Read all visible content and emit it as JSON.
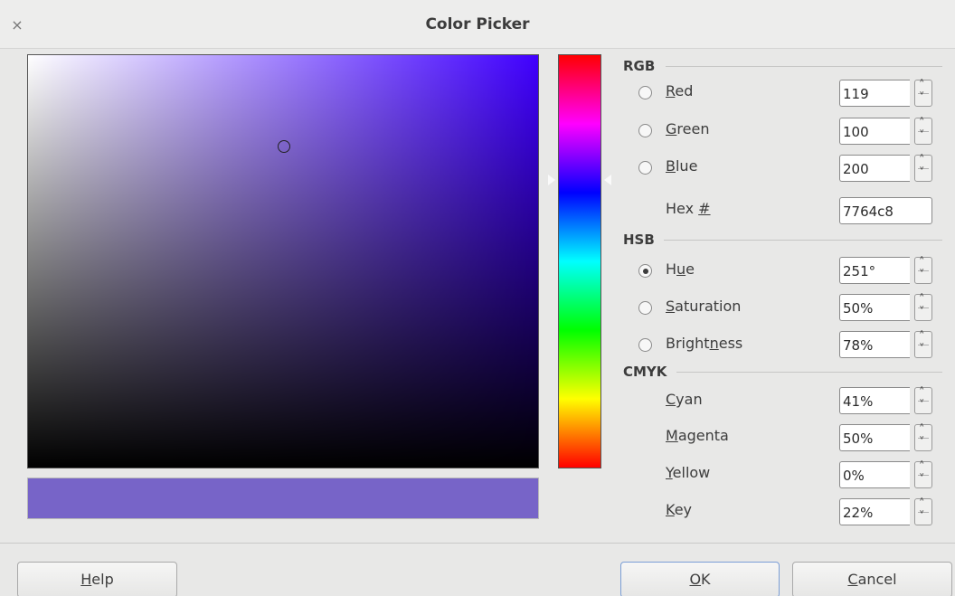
{
  "window": {
    "title": "Color Picker",
    "close_glyph": "×"
  },
  "current_color": "#7764c8",
  "hue_color": "#4000ff",
  "picker": {
    "hue_deg": 251,
    "saturation": 0.5,
    "brightness": 0.78
  },
  "sections": {
    "rgb": "RGB",
    "hsb": "HSB",
    "cmyk": "CMYK"
  },
  "rgb": {
    "red": {
      "label_pre": "",
      "label_u": "R",
      "label_post": "ed",
      "value": "119",
      "selected": false
    },
    "green": {
      "label_pre": "",
      "label_u": "G",
      "label_post": "reen",
      "value": "100",
      "selected": false
    },
    "blue": {
      "label_pre": "",
      "label_u": "B",
      "label_post": "lue",
      "value": "200",
      "selected": false
    },
    "hex": {
      "label_pre": "Hex ",
      "label_u": "#",
      "value": "7764c8"
    }
  },
  "hsb": {
    "hue": {
      "label_pre": "H",
      "label_u": "u",
      "label_post": "e",
      "value": "251°",
      "selected": true
    },
    "saturation": {
      "label_pre": "",
      "label_u": "S",
      "label_post": "aturation",
      "value": "50%",
      "selected": false
    },
    "brightness": {
      "label_pre": "Bright",
      "label_u": "n",
      "label_post": "ess",
      "value": "78%",
      "selected": false
    }
  },
  "cmyk": {
    "cyan": {
      "label_pre": "",
      "label_u": "C",
      "label_post": "yan",
      "value": "41%"
    },
    "magenta": {
      "label_pre": "",
      "label_u": "M",
      "label_post": "agenta",
      "value": "50%"
    },
    "yellow": {
      "label_pre": "",
      "label_u": "Y",
      "label_post": "ellow",
      "value": "0%"
    },
    "key": {
      "label_pre": "",
      "label_u": "K",
      "label_post": "ey",
      "value": "22%"
    }
  },
  "buttons": {
    "help": {
      "label_u": "H",
      "label_post": "elp"
    },
    "ok": {
      "label_u": "O",
      "label_post": "K"
    },
    "cancel": {
      "label_u": "C",
      "label_post": "ancel"
    }
  },
  "icons": {
    "close": "close-icon",
    "spin": "spin-arrows-icon",
    "hue_marker": "triangle-marker-icon"
  }
}
